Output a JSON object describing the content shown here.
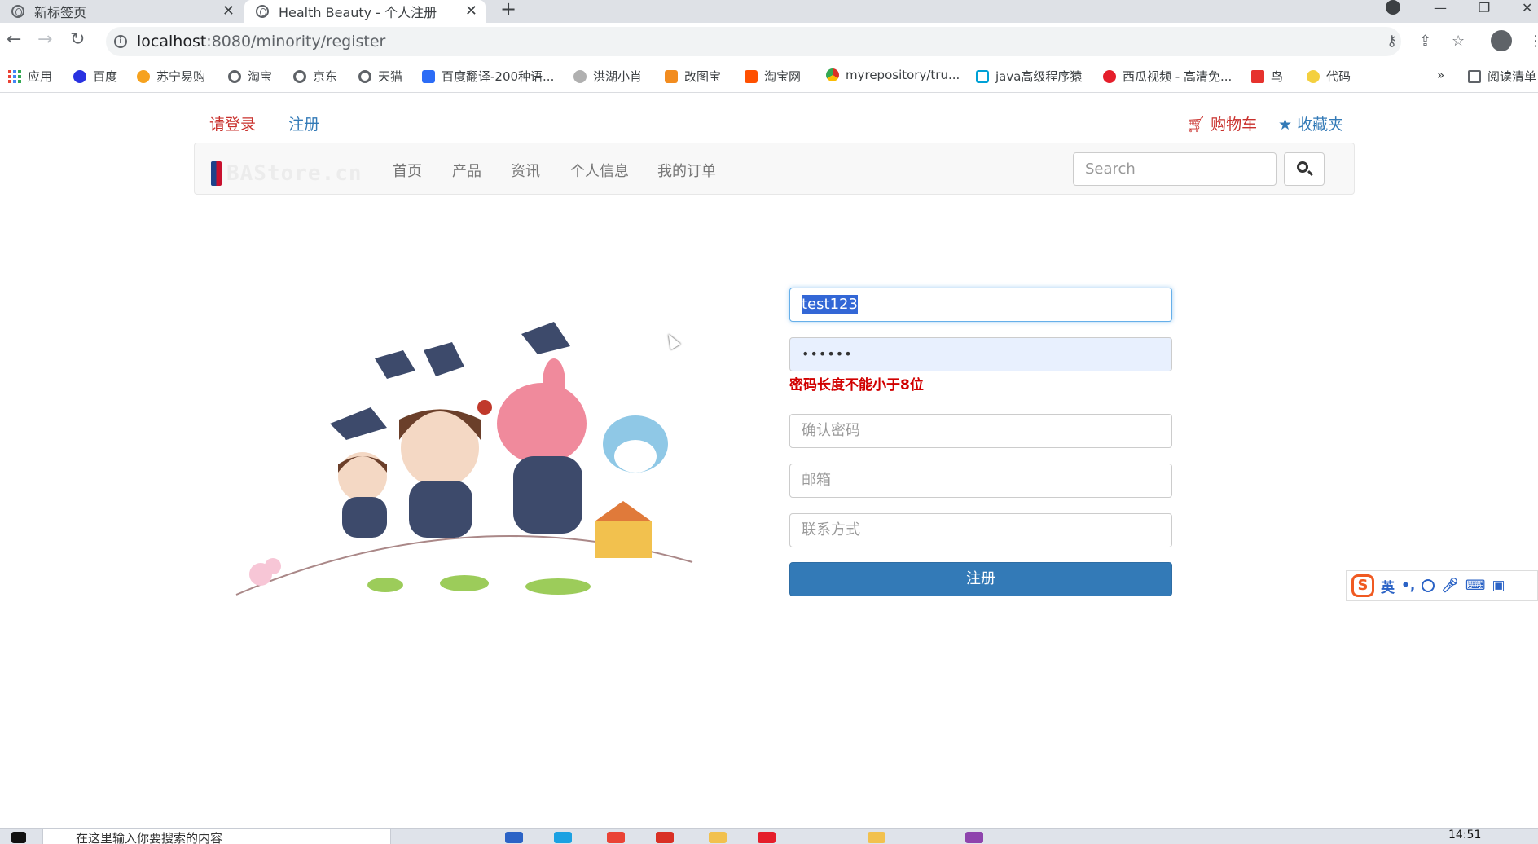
{
  "browser": {
    "tabs": [
      {
        "title": "新标签页"
      },
      {
        "title": "Health Beauty - 个人注册"
      }
    ],
    "url": {
      "host": "localhost",
      "rest": ":8080/minority/register"
    },
    "bookmarks": [
      {
        "label": "应用",
        "color": "#ea4335"
      },
      {
        "label": "百度",
        "color": "#2932e1"
      },
      {
        "label": "苏宁易购",
        "color": "#f6a21e"
      },
      {
        "label": "淘宝",
        "color": "#5f6368"
      },
      {
        "label": "京东",
        "color": "#5f6368"
      },
      {
        "label": "天猫",
        "color": "#5f6368"
      },
      {
        "label": "百度翻译-200种语...",
        "color": "#2c6cf6"
      },
      {
        "label": "洪湖小肖",
        "color": "#7a7a7a"
      },
      {
        "label": "改图宝",
        "color": "#f28c1f"
      },
      {
        "label": "淘宝网",
        "color": "#ff5000"
      },
      {
        "label": "myrepository/tru...",
        "color": "#d93025"
      },
      {
        "label": "java高级程序猿",
        "color": "#00a1d6"
      },
      {
        "label": "西瓜视频 - 高清免...",
        "color": "#e51e2b"
      },
      {
        "label": "鸟",
        "color": "#e6322d"
      },
      {
        "label": "代码",
        "color": "#f4d03f"
      },
      {
        "label": "阅读清单",
        "color": "#5f6368"
      }
    ],
    "more": "»"
  },
  "page": {
    "login_link": "请登录",
    "register_link": "注册",
    "cart": "购物车",
    "favorites": "收藏夹",
    "brand": "BAStore.cn",
    "nav": [
      "首页",
      "产品",
      "资讯",
      "个人信息",
      "我的订单"
    ],
    "search_placeholder": "Search"
  },
  "form": {
    "username_value": "test123",
    "password_value": "••••••",
    "error": "密码长度不能小于8位",
    "confirm_placeholder": "确认密码",
    "email_placeholder": "邮箱",
    "phone_placeholder": "联系方式",
    "submit": "注册"
  },
  "ime": {
    "lang": "英"
  },
  "taskbar": {
    "search": "在这里输入你要搜索的内容",
    "time": "14:51"
  }
}
